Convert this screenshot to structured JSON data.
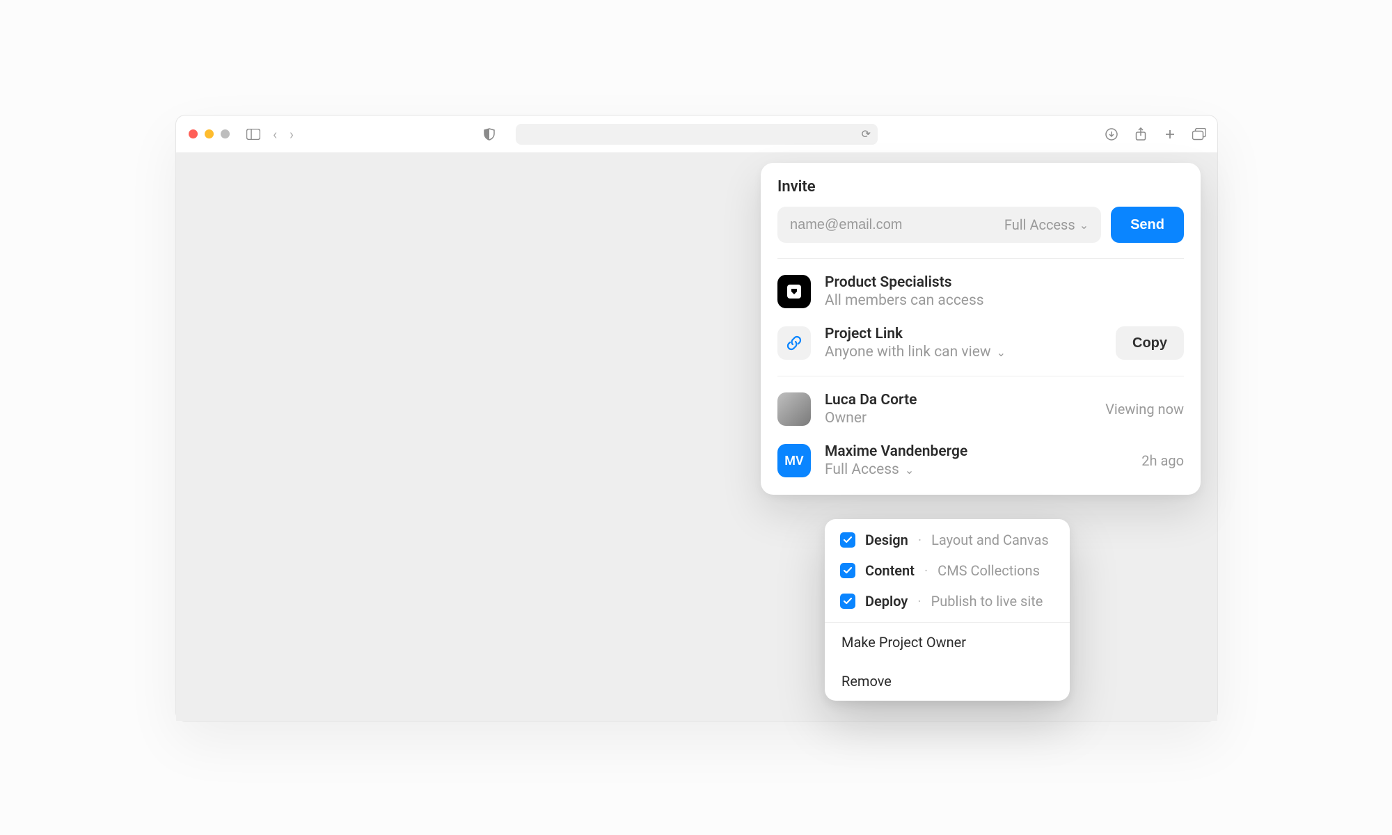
{
  "browser": {
    "address": "",
    "reload_icon": "⟳"
  },
  "panel": {
    "title": "Invite",
    "email_placeholder": "name@email.com",
    "access_level": "Full Access",
    "send_label": "Send",
    "org": {
      "name": "Product Specialists",
      "subtitle": "All members can access"
    },
    "link": {
      "title": "Project Link",
      "subtitle": "Anyone with link can view",
      "copy_label": "Copy"
    },
    "members": [
      {
        "name": "Luca Da Corte",
        "role": "Owner",
        "status": "Viewing now",
        "avatar_type": "photo",
        "initials": ""
      },
      {
        "name": "Maxime Vandenberge",
        "role": "Full Access",
        "status": "2h ago",
        "avatar_type": "initials",
        "initials": "MV"
      }
    ]
  },
  "dropdown": {
    "permissions": [
      {
        "label": "Design",
        "desc": "Layout and Canvas",
        "checked": true
      },
      {
        "label": "Content",
        "desc": "CMS Collections",
        "checked": true
      },
      {
        "label": "Deploy",
        "desc": "Publish to live site",
        "checked": true
      }
    ],
    "actions": {
      "make_owner": "Make Project Owner",
      "remove": "Remove"
    }
  }
}
